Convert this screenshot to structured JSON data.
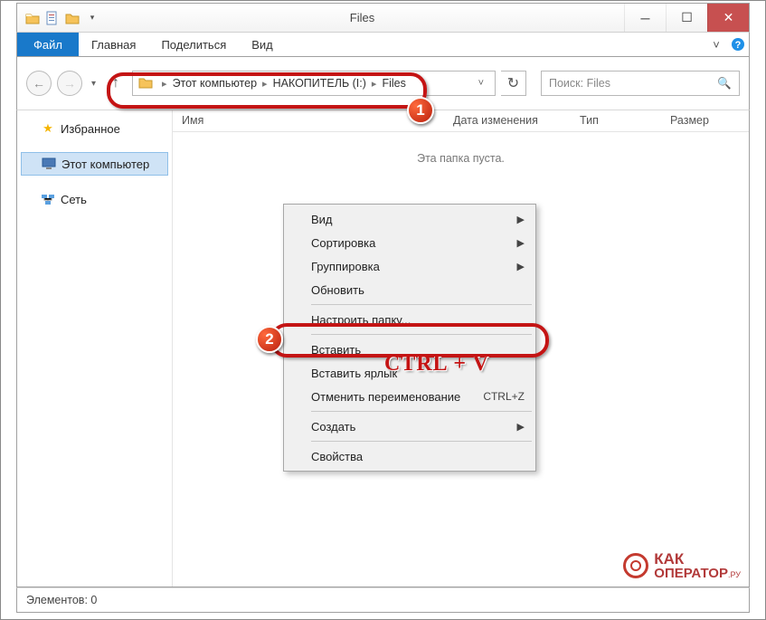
{
  "window": {
    "title": "Files"
  },
  "ribbon": {
    "file": "Файл",
    "tabs": [
      "Главная",
      "Поделиться",
      "Вид"
    ]
  },
  "breadcrumb": {
    "items": [
      "Этот компьютер",
      "НАКОПИТЕЛЬ (I:)",
      "Files"
    ]
  },
  "search": {
    "placeholder": "Поиск: Files"
  },
  "columns": {
    "name": "Имя",
    "date": "Дата изменения",
    "type": "Тип",
    "size": "Размер"
  },
  "empty_message": "Эта папка пуста.",
  "sidebar": {
    "favorites": "Избранное",
    "this_pc": "Этот компьютер",
    "network": "Сеть"
  },
  "context_menu": {
    "view": "Вид",
    "sort": "Сортировка",
    "group": "Группировка",
    "refresh": "Обновить",
    "customize": "Настроить папку...",
    "paste": "Вставить",
    "paste_shortcut": "Вставить ярлык",
    "undo_rename": "Отменить переименование",
    "undo_rename_sc": "CTRL+Z",
    "new": "Создать",
    "properties": "Свойства"
  },
  "status": {
    "items": "Элементов: 0"
  },
  "annotations": {
    "badge1": "1",
    "badge2": "2",
    "shortcut": "CTRL + V"
  },
  "watermark": {
    "line1": "КАК",
    "line2": "ОПЕРАТОР",
    "suffix": ".РУ"
  }
}
